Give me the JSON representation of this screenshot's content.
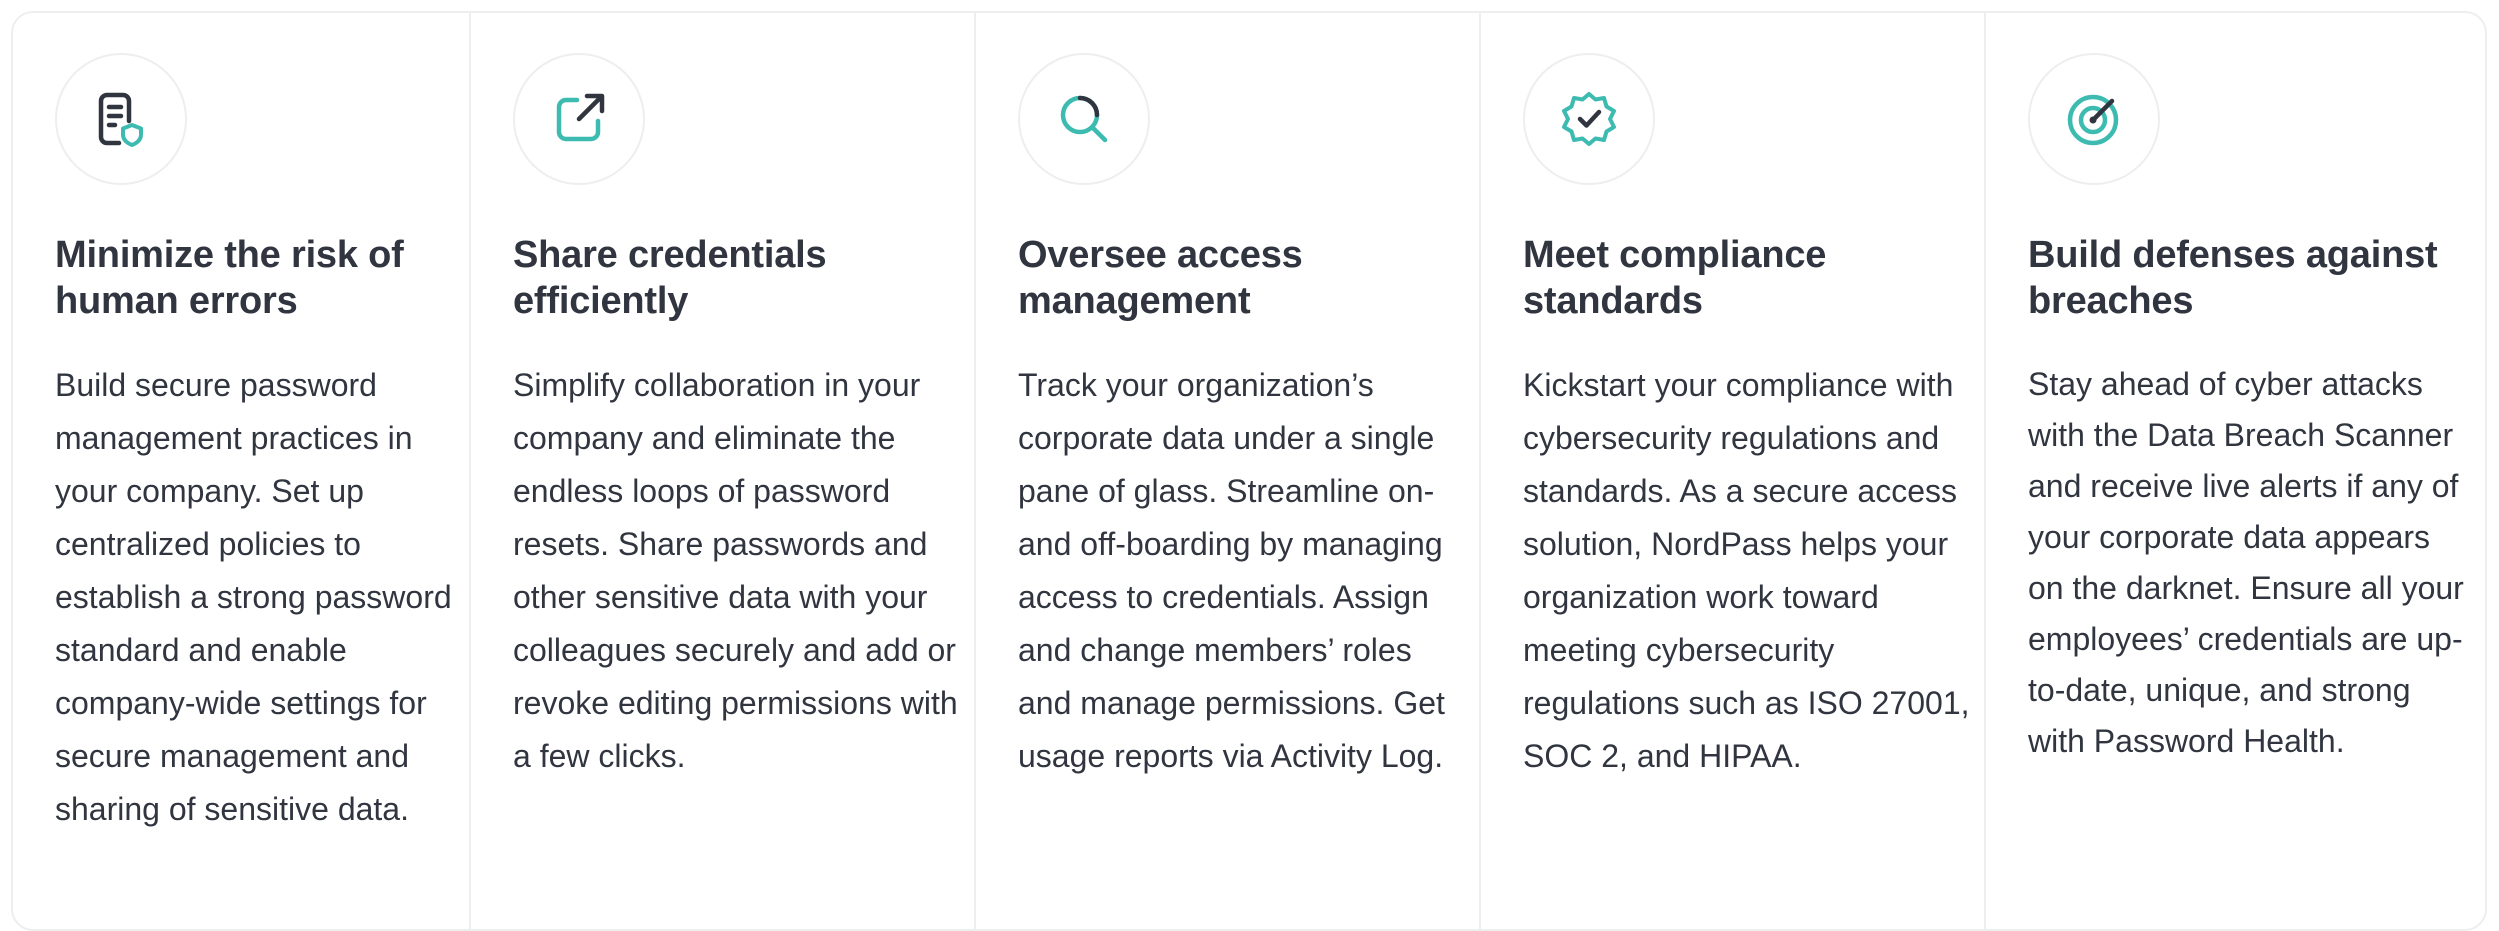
{
  "colors": {
    "accent": "#3ebbb1",
    "dark": "#30353f",
    "border": "#eceef0"
  },
  "cards": [
    {
      "icon": "document-shield-icon",
      "title": "Minimize the risk of human errors",
      "description": "Build secure password management practices in your company. Set up centralized policies to establish a strong password standard and enable company-wide settings for secure management and sharing of sensitive data."
    },
    {
      "icon": "external-share-icon",
      "title": "Share credentials efficiently",
      "description": "Simplify collaboration in your company and eliminate the endless loops of password resets. Share passwords and other sensitive data with your colleagues securely and add or revoke editing permissions with a few clicks."
    },
    {
      "icon": "search-magnifier-icon",
      "title": "Oversee access management",
      "description": "Track your organization’s corporate data under a single pane of glass. Streamline on- and off-boarding by managing access to credentials. Assign and change members’ roles and manage permissions. Get usage reports via Activity Log."
    },
    {
      "icon": "verified-badge-icon",
      "title": "Meet compliance standards",
      "description": "Kickstart your compliance with cybersecurity regulations and standards. As a secure access solution, NordPass helps your organization work toward meeting cybersecurity regulations such as ISO 27001, SOC 2, and HIPAA."
    },
    {
      "icon": "target-icon",
      "title": "Build defenses against breaches",
      "description": "Stay ahead of cyber attacks with the Data Breach Scanner and receive live alerts if any of your corporate data appears on the darknet. Ensure all your employees’ credentials are up-to-date, unique, and strong with Password Health."
    }
  ]
}
